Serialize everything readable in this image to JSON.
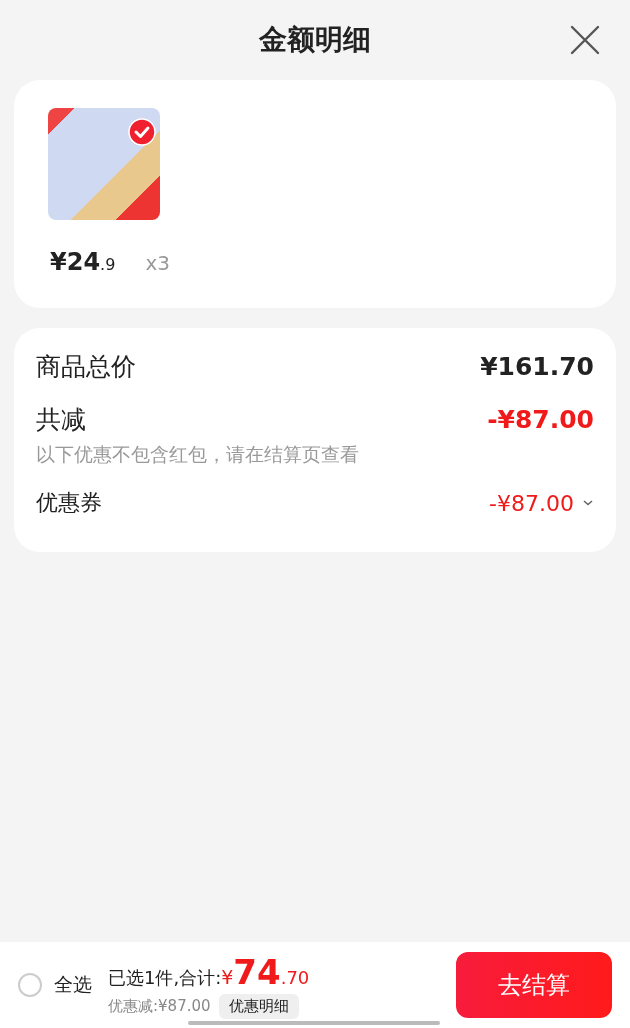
{
  "header": {
    "title": "金额明细"
  },
  "products": [
    {
      "selected": true,
      "price_integer": "¥24",
      "price_decimal": ".9",
      "quantity": "x3"
    }
  ],
  "summary": [
    {
      "kind": "total",
      "label": "商品总价",
      "amount": "¥161.70"
    },
    {
      "kind": "discount",
      "label": "共减",
      "amount": "-¥87.00",
      "note": "以下优惠不包含红包，请在结算页查看"
    },
    {
      "kind": "coupon",
      "label": "优惠券",
      "amount": "-¥87.00"
    }
  ],
  "footer": {
    "select_all": {
      "label": "全选",
      "checked": false
    },
    "selected_count": "已选1件,合计:",
    "currency": "¥",
    "total_integer": "74",
    "total_decimal": ".70",
    "discount": "优惠减:¥87.00",
    "details_button": "优惠明细",
    "checkout_button": "去结算"
  }
}
